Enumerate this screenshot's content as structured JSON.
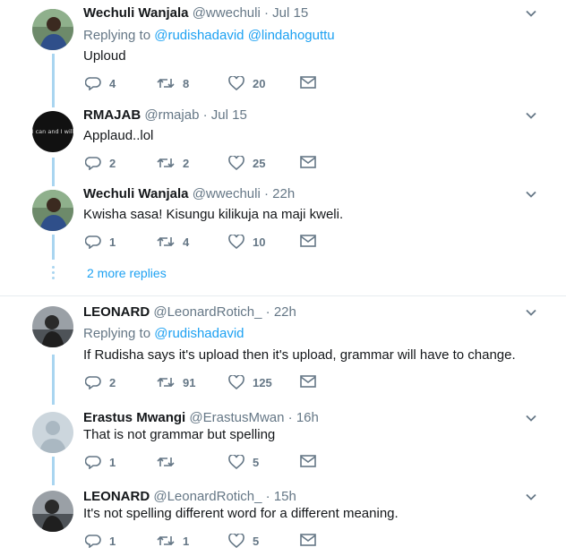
{
  "tweets": [
    {
      "name": "Wechuli Wanjala",
      "handle": "@wwechuli",
      "time": "Jul 15",
      "replying_prefix": "Replying to",
      "replying_to": [
        "@rudishadavid",
        "@lindahoguttu"
      ],
      "text": "Uploud",
      "replies": "4",
      "retweets": "8",
      "likes": "20"
    },
    {
      "name": "RMAJAB",
      "handle": "@rmajab",
      "time": "Jul 15",
      "avatar_text": "I can and I will",
      "text": "Applaud..lol",
      "replies": "2",
      "retweets": "2",
      "likes": "25"
    },
    {
      "name": "Wechuli Wanjala",
      "handle": "@wwechuli",
      "time": "22h",
      "text": "Kwisha sasa! Kisungu kilikuja na maji kweli.",
      "replies": "1",
      "retweets": "4",
      "likes": "10"
    },
    {
      "name": "LEONARD",
      "handle": "@LeonardRotich_",
      "time": "22h",
      "replying_prefix": "Replying to",
      "replying_to": [
        "@rudishadavid"
      ],
      "text": "If Rudisha says it's upload then it's upload, grammar will have to change.",
      "replies": "2",
      "retweets": "91",
      "likes": "125"
    },
    {
      "name": "Erastus Mwangi",
      "handle": "@ErastusMwan",
      "time": "16h",
      "text": "That is not grammar but spelling",
      "replies": "1",
      "retweets": "",
      "likes": "5"
    },
    {
      "name": "LEONARD",
      "handle": "@LeonardRotich_",
      "time": "15h",
      "text": "It's not spelling different word for a different meaning.",
      "replies": "1",
      "retweets": "1",
      "likes": "5"
    }
  ],
  "more_replies": "2 more replies",
  "separator": "·",
  "colors": {
    "link": "#1da1f2",
    "muted": "#657786",
    "thread": "#a9d5f0"
  },
  "icons": [
    "reply-icon",
    "retweet-icon",
    "like-icon",
    "dm-icon",
    "chevron-down-icon"
  ]
}
